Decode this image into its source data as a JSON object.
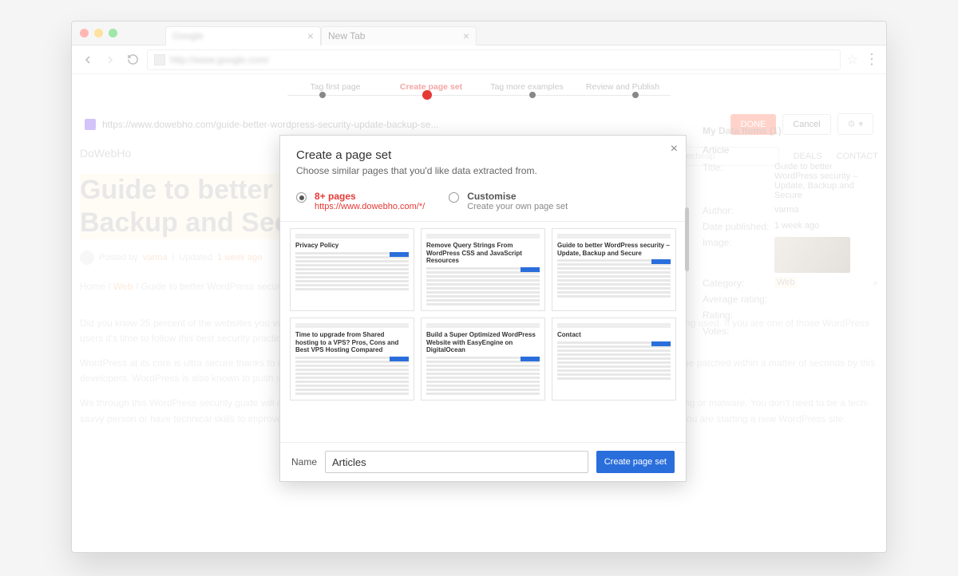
{
  "browser": {
    "tabs": [
      {
        "label": "Google",
        "blurred": true
      },
      {
        "label": "New Tab",
        "blurred": false
      }
    ],
    "address_url": "http://www.google.com/"
  },
  "steps": [
    "Tag first page",
    "Create page set",
    "Tag more examples",
    "Review and Publish"
  ],
  "active_step_index": 1,
  "toolbar": {
    "page_url": "https://www.dowebho.com/guide-better-wordpress-security-update-backup-se...",
    "done": "DONE",
    "cancel": "Cancel"
  },
  "page": {
    "sitename": "DoWebHo",
    "search_placeholder": "Search for Godaddy, Namecheap",
    "nav": [
      "DEALS",
      "CONTACT"
    ],
    "title_line1": "Guide to better W",
    "title_line2": "Backup and Secu",
    "byline_prefix": "Posted by",
    "byline_author": "varma",
    "byline_mid": "Updated",
    "byline_time": "1 week ago",
    "breadcrumb_home": "Home",
    "breadcrumb_cat": "Web",
    "breadcrumb_rest": "Guide to better WordPress securit",
    "para1": "Did you know 25 percent of the websites you visit are powered by WordPress at its core? Be it ecommerce site, news websites, WordPress being used. If you are one of those WordPress users it's time to follow this best security practices to keep your WordPress site safe.",
    "para2": "WordPress at its core is ultra secure thanks to its open source nature and team of dedicated developers, any security issues found will usually be patched within a matter of seconds by this developers. WordPress is also known to push security updates immediately to its users.",
    "para3": "We through this WordPress security guide will cover some simple security tips you can follow to make your website safe and secure from hacking or malware. You don't need to be a tech-savvy person or have technical skills to improve your WordPress website security. Do note that most of this steps are way easy to apply when you are starting a new WordPress site."
  },
  "sidepanel": {
    "header": "My Data Items (1)",
    "section": "Article",
    "rows": {
      "title_k": "Title:",
      "title_v": "Guide to better WordPress security – Update, Backup and Secure",
      "author_k": "Author:",
      "author_v": "varma",
      "date_k": "Date published:",
      "date_v": "1 week ago",
      "image_k": "Image:",
      "cat_k": "Category:",
      "cat_v": "Web",
      "avg_k": "Average rating:",
      "rating_k": "Rating:",
      "votes_k": "Votes:"
    }
  },
  "modal": {
    "title": "Create a page set",
    "subtitle": "Choose similar pages that you'd like data extracted from.",
    "option1_label": "8+ pages",
    "option1_sub": "https://www.dowebho.com/*/",
    "option2_label": "Customise",
    "option2_sub": "Create your own page set",
    "thumbs": [
      "Privacy Policy",
      "Remove Query Strings From WordPress CSS and JavaScript Resources",
      "Guide to better WordPress security – Update, Backup and Secure",
      "Time to upgrade from Shared hosting to a VPS? Pros, Cons and Best VPS Hosting Compared",
      "Build a Super Optimized WordPress Website with EasyEngine on DigitalOcean",
      "Contact"
    ],
    "name_label": "Name",
    "name_value": "Articles",
    "create_btn": "Create page set"
  }
}
